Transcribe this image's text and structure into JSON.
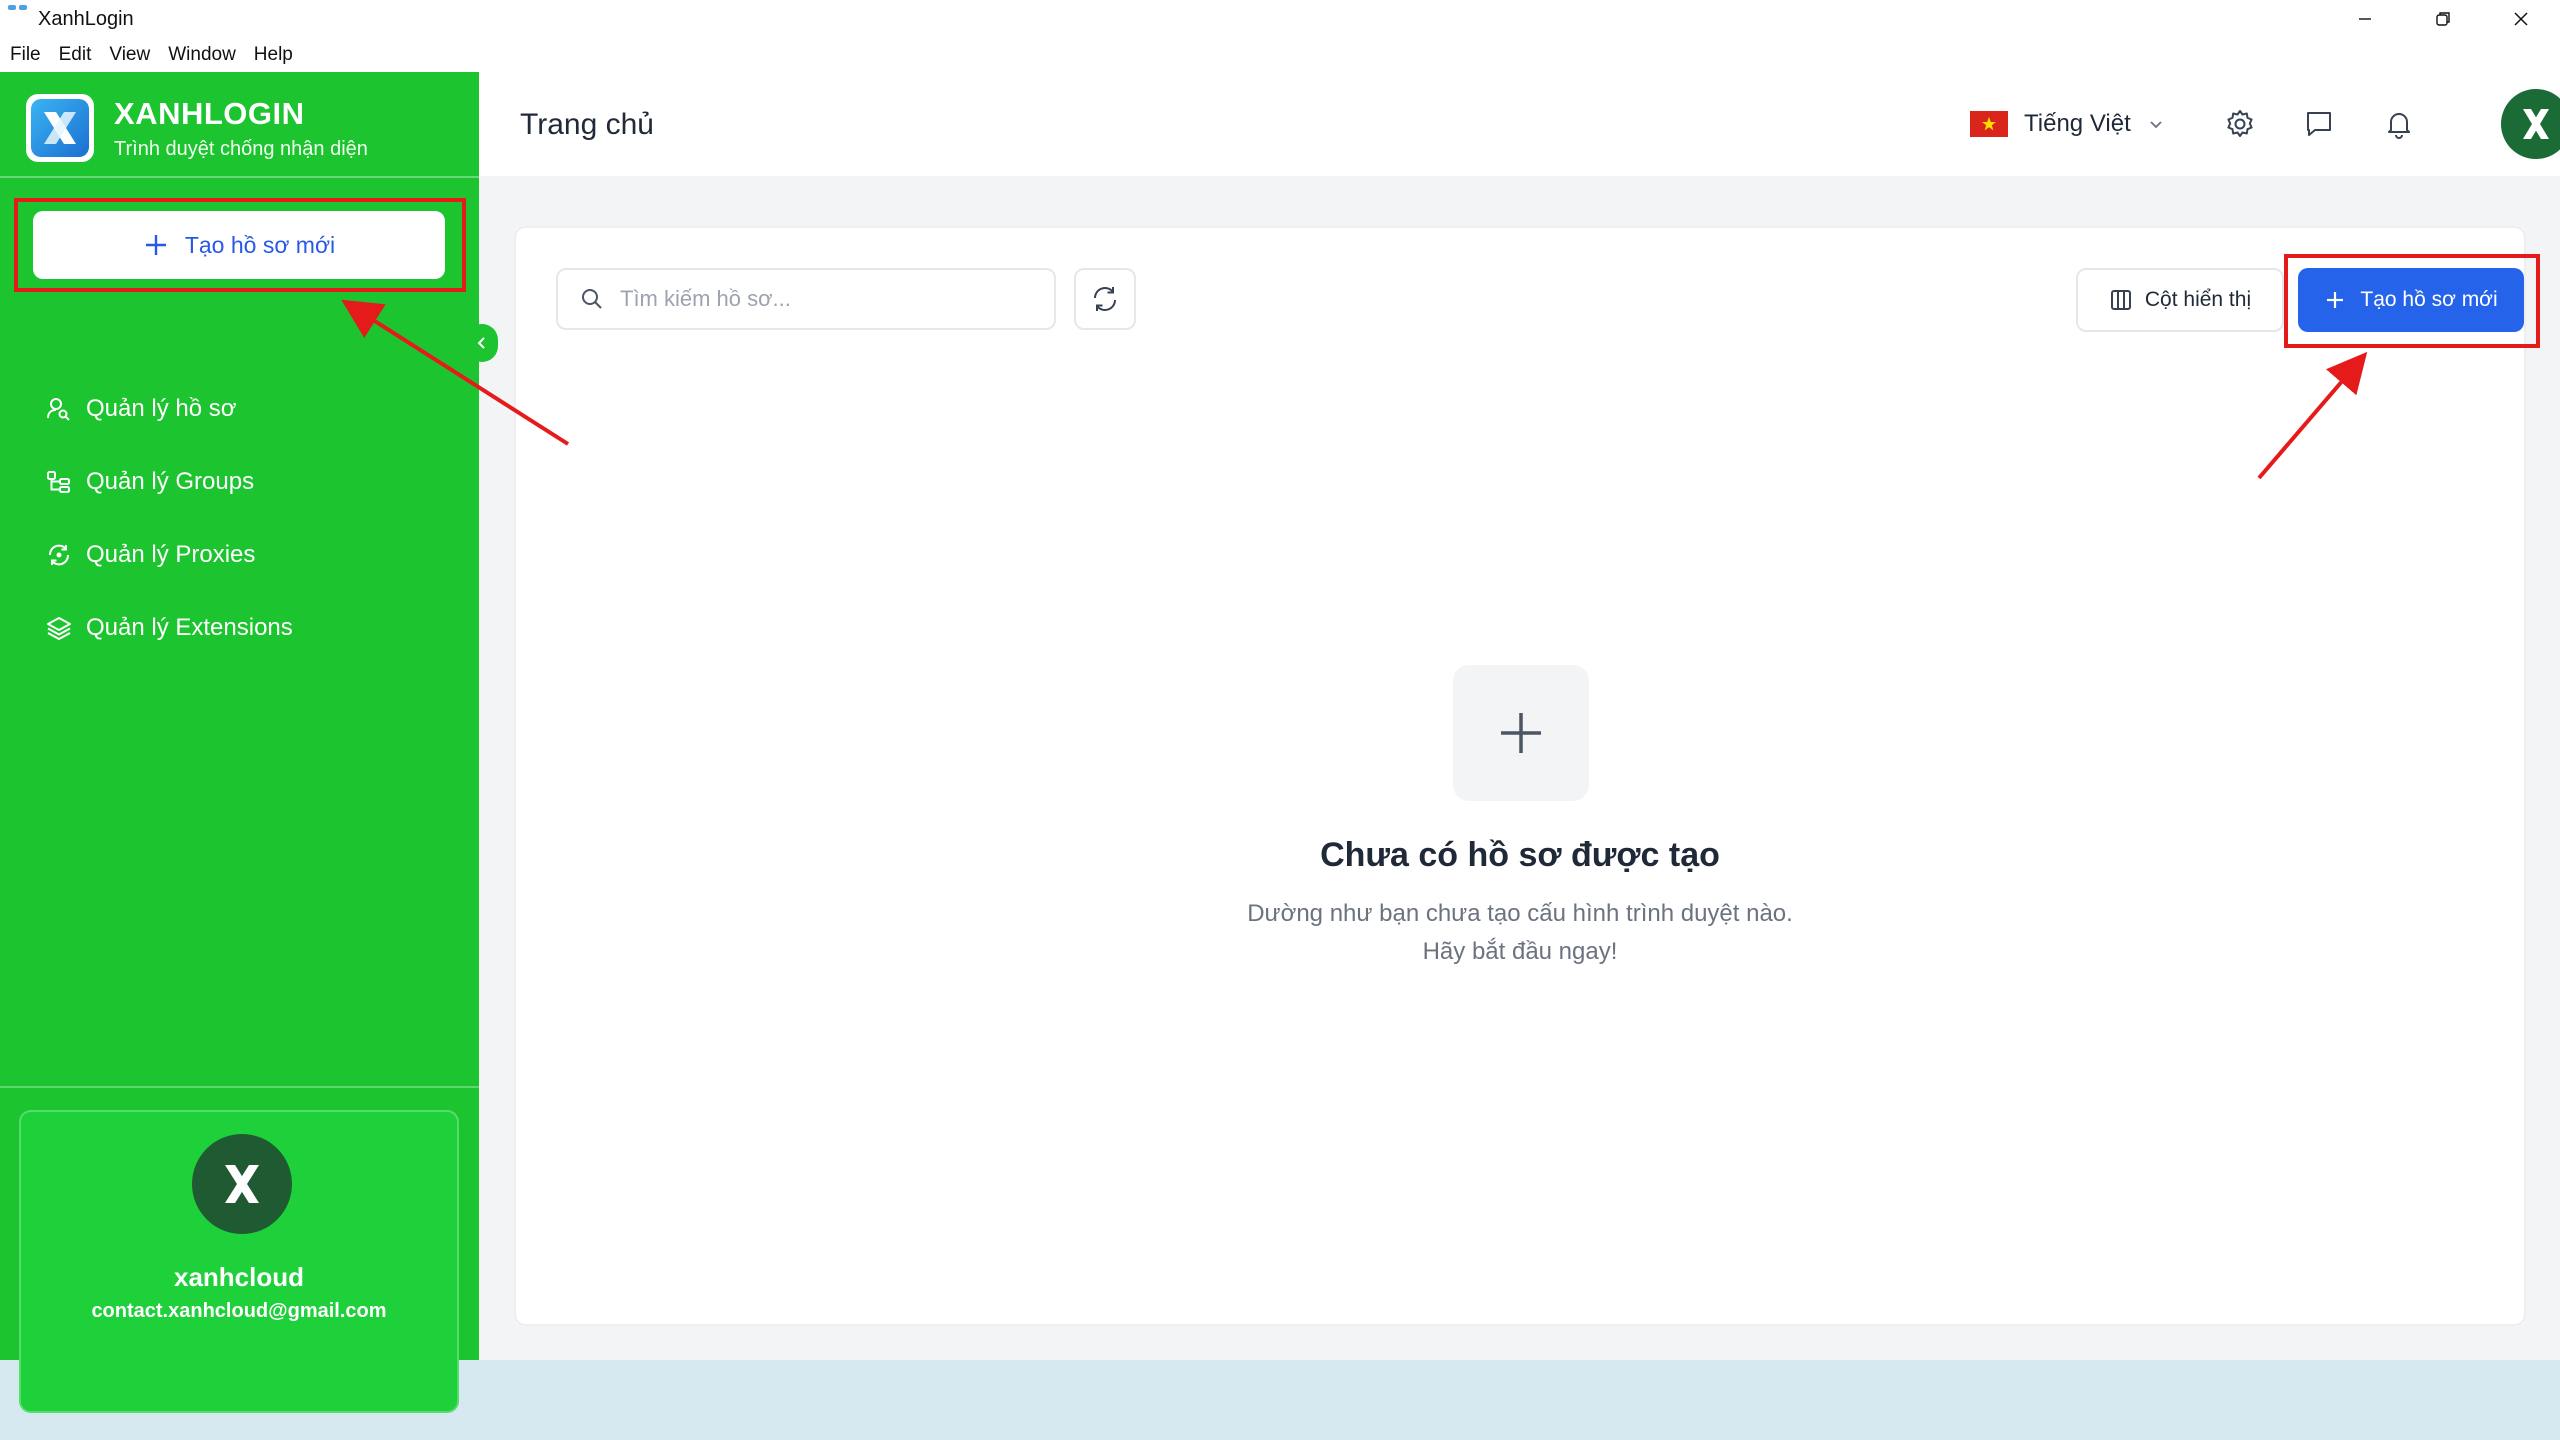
{
  "window": {
    "title": "XanhLogin",
    "menu": [
      "File",
      "Edit",
      "View",
      "Window",
      "Help"
    ]
  },
  "sidebar": {
    "brand_name": "XANHLOGIN",
    "brand_subtitle": "Trình duyệt chống nhận diện",
    "new_profile_label": "Tạo hồ sơ mới",
    "items": [
      {
        "label": "Quản lý hồ sơ",
        "icon": "user-search-icon"
      },
      {
        "label": "Quản lý Groups",
        "icon": "groups-icon"
      },
      {
        "label": "Quản lý Proxies",
        "icon": "proxy-refresh-icon"
      },
      {
        "label": "Quản lý Extensions",
        "icon": "layers-icon"
      }
    ],
    "account": {
      "name": "xanhcloud",
      "email": "contact.xanhcloud@gmail.com"
    }
  },
  "header": {
    "title": "Trang chủ",
    "language": "Tiếng Việt"
  },
  "toolbar": {
    "search_placeholder": "Tìm kiếm hồ sơ...",
    "columns_label": "Cột hiển thị",
    "create_label": "Tạo hồ sơ mới"
  },
  "empty_state": {
    "title": "Chưa có hồ sơ được tạo",
    "line1": "Dường như bạn chưa tạo cấu hình trình duyệt nào.",
    "line2": "Hãy bắt đầu ngay!"
  },
  "colors": {
    "sidebar_green": "#1cc42f",
    "primary_blue": "#2563eb",
    "highlight_red": "#e51b1b"
  }
}
